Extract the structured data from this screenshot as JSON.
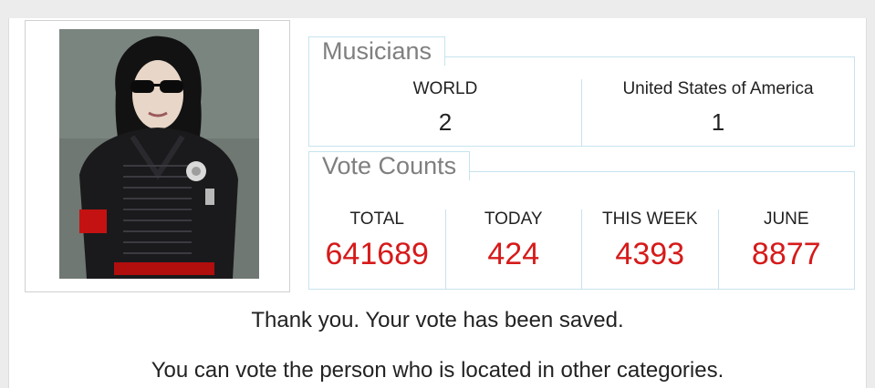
{
  "musicians": {
    "title": "Musicians",
    "columns": [
      {
        "label": "WORLD",
        "value": "2"
      },
      {
        "label": "United States of America",
        "value": "1"
      }
    ]
  },
  "vote_counts": {
    "title": "Vote Counts",
    "columns": [
      {
        "label": "TOTAL",
        "value": "641689"
      },
      {
        "label": "TODAY",
        "value": "424"
      },
      {
        "label": "THIS WEEK",
        "value": "4393"
      },
      {
        "label": "JUNE",
        "value": "8877"
      }
    ]
  },
  "messages": {
    "saved": "Thank you. Your vote has been saved.",
    "other": "You can vote the person who is located in other categories."
  },
  "colors": {
    "vote_value": "#d61a1a",
    "border": "#c7e3ef",
    "title": "#7f7f7f"
  }
}
